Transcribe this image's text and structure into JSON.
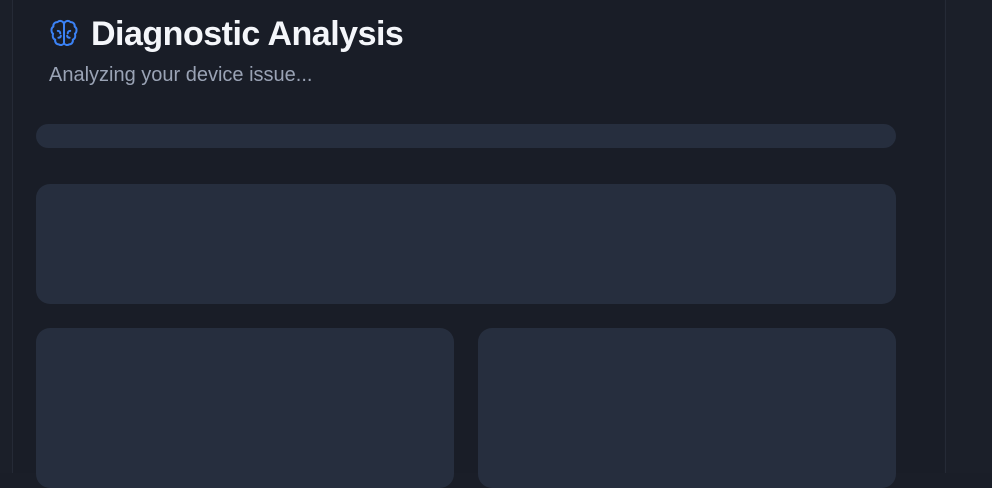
{
  "header": {
    "icon": "brain-icon",
    "title": "Diagnostic Analysis",
    "subtitle": "Analyzing your device issue..."
  },
  "colors": {
    "background": "#191d27",
    "accent": "#3b82f6",
    "skeleton": "#262e3e",
    "title": "#f4f6fa",
    "subtitle": "#9aa3b5"
  }
}
